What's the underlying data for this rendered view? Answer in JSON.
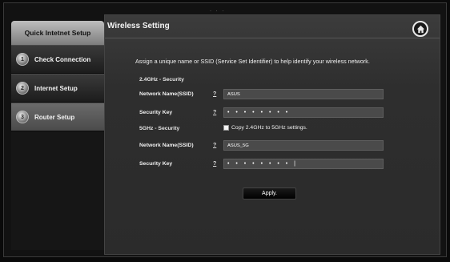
{
  "top_dots": "· · ·",
  "sidebar": {
    "header": "Quick Intetnet Setup",
    "items": [
      {
        "label": "Check Connection",
        "icon": "1"
      },
      {
        "label": "Internet Setup",
        "icon": "2"
      },
      {
        "label": "Router Setup",
        "icon": "3",
        "active": true
      }
    ]
  },
  "main": {
    "title": "Wireless Setting",
    "intro": "Assign a unique name or SSID (Service Set Identifier) to help identify your wireless network.",
    "band24": {
      "section": "2.4GHz - Security",
      "ssid_label": "Network Name(SSID)",
      "ssid_value": "ASUS",
      "key_label": "Security Key",
      "key_value": "• • • • • • • •"
    },
    "band5": {
      "section": "5GHz - Security",
      "copy_label": "Copy 2.4GHz to 5GHz settings.",
      "ssid_label": "Network Name(SSID)",
      "ssid_value": "ASUS_5G",
      "key_label": "Security Key",
      "key_value": "• • • • • • • • |"
    },
    "help_mark": "?",
    "apply_label": "Apply."
  }
}
